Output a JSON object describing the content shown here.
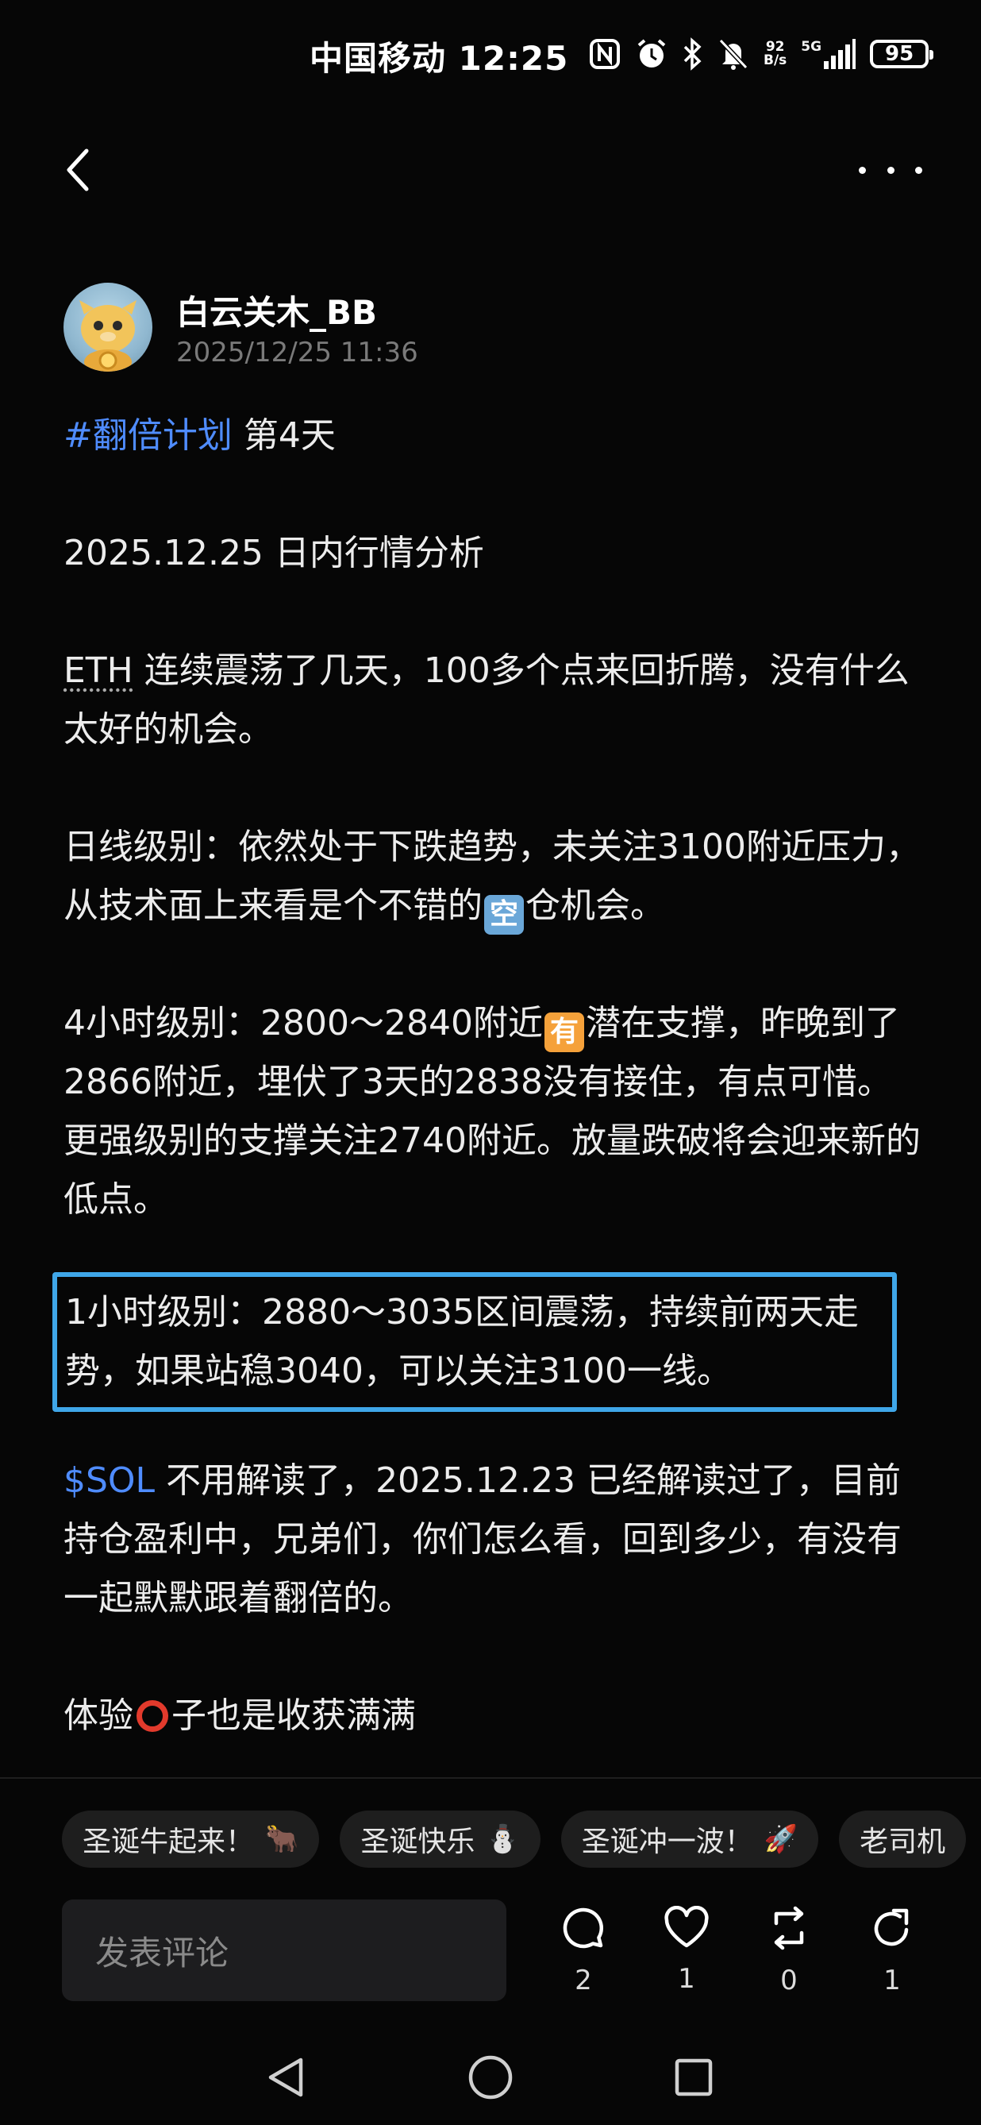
{
  "status_bar": {
    "carrier_time": "中国移动 12:25",
    "net_speed_value": "92",
    "net_speed_unit": "B/s",
    "network": "5G",
    "battery": "95",
    "icons": [
      "nfc-icon",
      "alarm-icon",
      "bluetooth-icon",
      "mute-icon",
      "net-speed-icon",
      "signal-icon",
      "battery-icon"
    ]
  },
  "nav": {
    "back_icon": "chevron-left-icon",
    "more_icon": "more-dots-icon"
  },
  "author": {
    "name": "白云关木_BB",
    "time": "2025/12/25 11:36"
  },
  "post": {
    "hashtag": "#翻倍计划",
    "title_rest": " 第4天",
    "date_line": "2025.12.25  日内行情分析",
    "eth_tag": "ETH",
    "eth_text": " 连续震荡了几天，100多个点来回折腾，没有什么太好的机会。",
    "daily_pre": "日线级别：依然处于下跌趋势，未关注3100附近压力，从技术面上来看是个不错的",
    "daily_emoji": "空",
    "daily_post": "仓机会。",
    "h4_pre": "4小时级别：2800～2840附近",
    "h4_emoji": "有",
    "h4_post": "潜在支撑，昨晚到了2866附近，埋伏了3天的2838没有接住，有点可惜。更强级别的支撑关注2740附近。放量跌破将会迎来新的低点。",
    "h1_text": "1小时级别：2880～3035区间震荡，持续前两天走势，如果站稳3040，可以关注3100一线。",
    "sol_tag": "$SOL",
    "sol_text": " 不用解读了，2025.12.23 已经解读过了，目前持仓盈利中，兄弟们，你们怎么看，回到多少，有没有一起默默跟着翻倍的。",
    "exp_pre": "体验",
    "exp_post": "子也是收获满满"
  },
  "chips": [
    {
      "label": "圣诞牛起来！",
      "emoji": "🐂"
    },
    {
      "label": "圣诞快乐",
      "emoji": "⛄"
    },
    {
      "label": "圣诞冲一波！",
      "emoji": "🚀"
    },
    {
      "label": "老司机",
      "emoji": ""
    }
  ],
  "comment": {
    "placeholder": "发表评论"
  },
  "actions": {
    "comments": "2",
    "likes": "1",
    "reposts": "0",
    "shares": "1"
  },
  "system_nav": [
    "back-triangle-icon",
    "home-circle-icon",
    "recents-square-icon"
  ],
  "colors": {
    "background": "#060606",
    "link": "#4f8cff",
    "highlight_border": "#3fa6e8",
    "muted_text": "#7a7a7a"
  }
}
